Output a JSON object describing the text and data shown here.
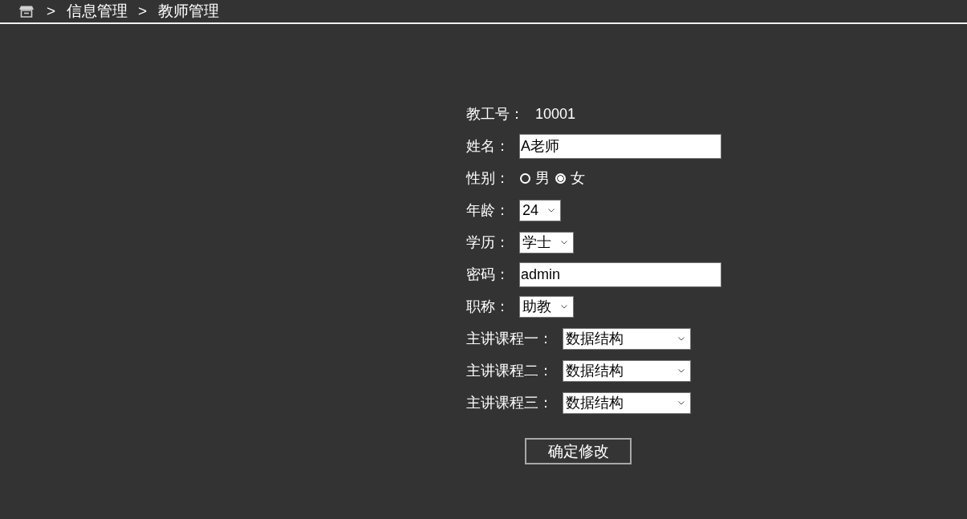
{
  "breadcrumb": [
    {
      "kind": "separator",
      "text": ">"
    },
    {
      "kind": "link",
      "text": "信息管理"
    },
    {
      "kind": "separator",
      "text": ">"
    },
    {
      "kind": "link",
      "text": "教师管理"
    }
  ],
  "form": {
    "fields": [
      {
        "kind": "static",
        "label": "教工号：",
        "value": "10001"
      },
      {
        "kind": "input",
        "label": "姓名：",
        "value": "A老师"
      },
      {
        "kind": "radio",
        "label": "性别：",
        "options": [
          {
            "label": "男",
            "selected": false
          },
          {
            "label": "女",
            "selected": true
          }
        ]
      },
      {
        "kind": "select",
        "label": "年龄：",
        "value": "24"
      },
      {
        "kind": "select",
        "label": "学历：",
        "value": "学士"
      },
      {
        "kind": "input",
        "label": "密码：",
        "value": "admin"
      },
      {
        "kind": "select",
        "label": "职称：",
        "value": "助教"
      }
    ],
    "courses": [
      {
        "label": "主讲课程一：",
        "value": "数据结构"
      },
      {
        "label": "主讲课程二：",
        "value": "数据结构"
      },
      {
        "label": "主讲课程三：",
        "value": "数据结构"
      }
    ],
    "submit": {
      "label": "确定修改"
    }
  }
}
